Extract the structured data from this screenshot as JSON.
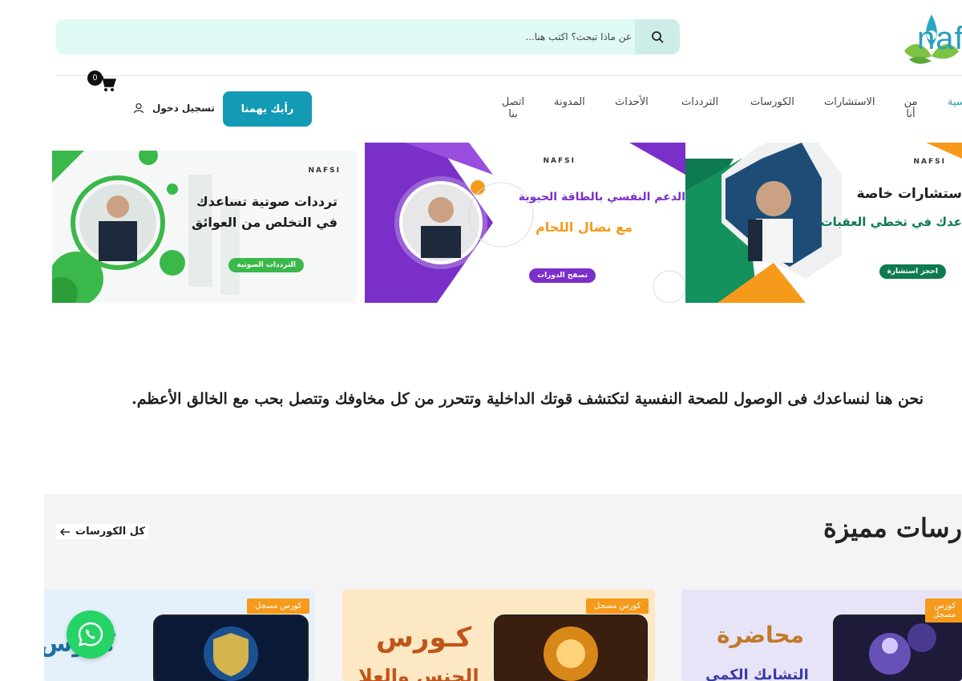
{
  "brand": {
    "logo_text": "naf"
  },
  "search": {
    "placeholder": "عن ماذا تبحث؟ اكتب هنا..."
  },
  "nav": {
    "items": [
      {
        "label": "سية",
        "active": true
      },
      {
        "label": "من أنا"
      },
      {
        "label": "الاستشارات"
      },
      {
        "label": "الكورسات"
      },
      {
        "label": "الترددات"
      },
      {
        "label": "الأحداث"
      },
      {
        "label": "المدونة"
      },
      {
        "label": "اتصل بنا"
      }
    ],
    "cta_label": "رأيك يهمنا",
    "login_label": "تسجيل دخول",
    "cart_count": "0"
  },
  "banners": [
    {
      "brand": "NAFSI",
      "title": "ستشارات خاصة",
      "subtitle": "عدك في تخطي العقبات",
      "button": "احجز استشارة",
      "accent": "#0e7a4f"
    },
    {
      "brand": "NAFSI",
      "title": "الدعم النفسي بالطاقة الحيوية",
      "subtitle": "مع نضال اللحام",
      "button": "تصفح الدورات",
      "accent": "#7a2fc9"
    },
    {
      "brand": "NAFSI",
      "title": "ترددات صوتية تساعدك",
      "subtitle": "في التخلص من العوائق",
      "button": "الترددات الصوتية",
      "accent": "#3bb84a"
    }
  ],
  "tagline": "نحن هنا لنساعدك فى الوصول للصحة النفسية لتكتشف قوتك الداخلية وتتحرر من كل مخاوفك وتتصل بحب مع الخالق الأعظم.",
  "featured": {
    "title": "رسات مميزة",
    "all_label": "كل الكورسات",
    "cards": [
      {
        "tag": "كورس مسجل",
        "heading": "محاضرة",
        "sub": "التشابك الكمي"
      },
      {
        "tag": "كورس مسجل",
        "heading": "كـورس",
        "sub": "الجنس والعلا"
      },
      {
        "tag": "كورس مسجل",
        "heading": "كورس",
        "sub": ""
      }
    ]
  },
  "colors": {
    "primary": "#139ab5",
    "search_bg": "#dffaf4",
    "orange": "#f59a1b"
  }
}
